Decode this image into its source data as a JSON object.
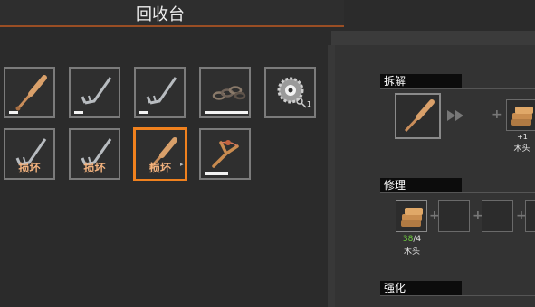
{
  "header": {
    "title": "回收台"
  },
  "inventory": {
    "slots": [
      {
        "item": "baseball-bat",
        "durability": 0.2,
        "broken": false
      },
      {
        "item": "crowbar",
        "durability": 0.2,
        "broken": false
      },
      {
        "item": "crowbar",
        "durability": 0.2,
        "broken": false
      },
      {
        "item": "chain",
        "durability": 0.95,
        "broken": false
      },
      {
        "item": "gear-with-key",
        "durability": null,
        "broken": false,
        "count": "1"
      },
      {
        "item": "crowbar",
        "durability": null,
        "broken": true,
        "label": "损坏"
      },
      {
        "item": "crowbar",
        "durability": null,
        "broken": true,
        "label": "损坏"
      },
      {
        "item": "baseball-bat",
        "durability": null,
        "broken": true,
        "label": "损坏",
        "selected": true
      },
      {
        "item": "slingshot",
        "durability": 0.5,
        "broken": false
      }
    ]
  },
  "dismantle": {
    "title": "拆解",
    "input_item": "baseball-bat",
    "output": {
      "item": "wood-planks",
      "count": "+1",
      "name": "木头"
    }
  },
  "repair": {
    "title": "修理",
    "material": {
      "item": "wood-planks",
      "have": "38",
      "need": "4",
      "name": "木头"
    }
  },
  "upgrade": {
    "title": "强化"
  },
  "colors": {
    "accent_orange": "#f0811e",
    "broken_text": "#f3b27e",
    "ratio_green": "#6fcf3f"
  }
}
